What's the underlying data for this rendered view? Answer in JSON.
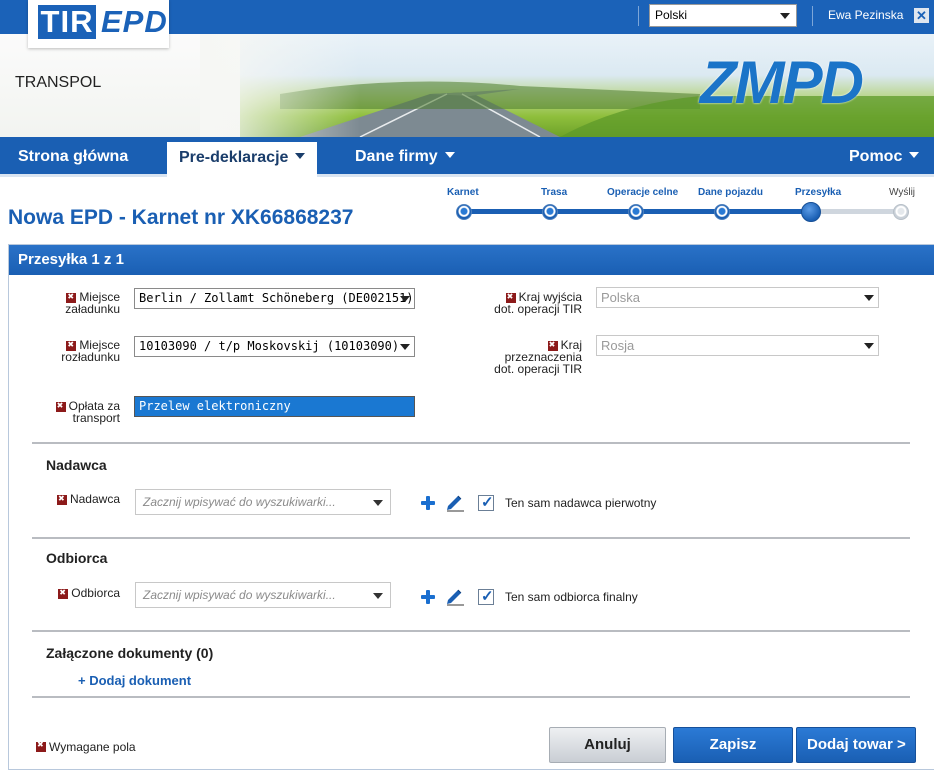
{
  "app": {
    "logo_tir": "TIR",
    "logo_epd": "EPD",
    "company": "TRANSPOL",
    "brand": "ZMPD",
    "accent": "#1a5fb3"
  },
  "topbar": {
    "language": "Polski",
    "user": "Ewa Pezinska",
    "close_icon": "close-icon"
  },
  "nav": {
    "home": "Strona główna",
    "predecl": "Pre-deklaracje",
    "company": "Dane firmy",
    "help": "Pomoc"
  },
  "page": {
    "title": "Nowa EPD - Karnet nr XK66868237"
  },
  "stepper": {
    "steps": [
      {
        "label": "Karnet",
        "state": "done"
      },
      {
        "label": "Trasa",
        "state": "done"
      },
      {
        "label": "Operacje celne",
        "state": "done"
      },
      {
        "label": "Dane pojazdu",
        "state": "done"
      },
      {
        "label": "Przesyłka",
        "state": "current"
      },
      {
        "label": "Wyślij",
        "state": "todo"
      }
    ]
  },
  "panel": {
    "title": "Przesyłka 1 z 1"
  },
  "form": {
    "loading_label_1": "Miejsce",
    "loading_label_2": "załadunku",
    "loading_value": "Berlin / Zollamt Schöneberg (DE002151)",
    "unloading_label_1": "Miejsce",
    "unloading_label_2": "rozładunku",
    "unloading_value": "10103090 / t/p Moskovskij (10103090)",
    "fee_label_1": "Opłata za",
    "fee_label_2": "transport",
    "fee_value": "Przelew elektroniczny",
    "exit_label_1": "Kraj wyjścia",
    "exit_label_2": "dot. operacji TIR",
    "exit_value": "Polska",
    "dest_label_1": "Kraj",
    "dest_label_2": "przeznaczenia",
    "dest_label_3": "dot. operacji TIR",
    "dest_value": "Rosja"
  },
  "sender": {
    "section": "Nadawca",
    "label": "Nadawca",
    "placeholder": "Zacznij wpisywać do wyszukiwarki...",
    "checkbox": "Ten sam nadawca pierwotny",
    "checked": true
  },
  "receiver": {
    "section": "Odbiorca",
    "label": "Odbiorca",
    "placeholder": "Zacznij wpisywać do wyszukiwarki...",
    "checkbox": "Ten sam odbiorca finalny",
    "checked": true
  },
  "docs": {
    "section": "Załączone dokumenty (0)",
    "add_link": "+ Dodaj dokument"
  },
  "footer": {
    "required_legend": "Wymagane pola",
    "cancel": "Anuluj",
    "save": "Zapisz",
    "add_goods": "Dodaj towar >"
  }
}
